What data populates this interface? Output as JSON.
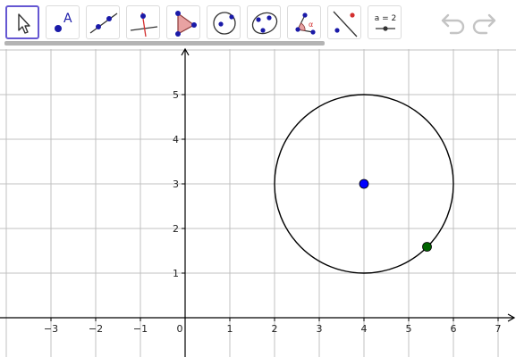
{
  "toolbar": {
    "tools": [
      {
        "name": "move-tool",
        "icon": "pointer-arrow-icon",
        "active": true
      },
      {
        "name": "point-tool",
        "icon": "point-label-icon",
        "label": "A"
      },
      {
        "name": "line-tool",
        "icon": "line-through-points-icon"
      },
      {
        "name": "perpendicular-line-tool",
        "icon": "perpendicular-line-icon"
      },
      {
        "name": "polygon-tool",
        "icon": "polygon-icon"
      },
      {
        "name": "circle-center-point-tool",
        "icon": "circle-center-point-icon"
      },
      {
        "name": "ellipse-tool",
        "icon": "ellipse-icon"
      },
      {
        "name": "angle-tool",
        "icon": "angle-icon",
        "label": "α"
      },
      {
        "name": "reflect-tool",
        "icon": "reflect-about-line-icon"
      },
      {
        "name": "slider-tool",
        "icon": "slider-icon",
        "label": "a = 2"
      }
    ],
    "undo_icon": "undo-arrow-icon",
    "redo_icon": "redo-arrow-icon"
  },
  "graphics": {
    "x_ticks": [
      {
        "value": -3,
        "label": "−3"
      },
      {
        "value": -2,
        "label": "−2"
      },
      {
        "value": -1,
        "label": "−1"
      },
      {
        "value": 0,
        "label": "0"
      },
      {
        "value": 1,
        "label": "1"
      },
      {
        "value": 2,
        "label": "2"
      },
      {
        "value": 3,
        "label": "3"
      },
      {
        "value": 4,
        "label": "4"
      },
      {
        "value": 5,
        "label": "5"
      },
      {
        "value": 6,
        "label": "6"
      },
      {
        "value": 7,
        "label": "7"
      }
    ],
    "y_ticks": [
      {
        "value": 1,
        "label": "1"
      },
      {
        "value": 2,
        "label": "2"
      },
      {
        "value": 3,
        "label": "3"
      },
      {
        "value": 4,
        "label": "4"
      },
      {
        "value": 5,
        "label": "5"
      }
    ],
    "objects": {
      "circle": {
        "center_x": 4,
        "center_y": 3,
        "radius": 2,
        "color": "#000000"
      },
      "center_point": {
        "x": 4,
        "y": 3,
        "color": "#0000ff"
      },
      "circle_point": {
        "x": 5.41,
        "y": 1.59,
        "color": "#006400"
      }
    },
    "colors": {
      "axis": "#000000",
      "grid": "#c0c0c0",
      "accent": "#6557d2"
    }
  }
}
